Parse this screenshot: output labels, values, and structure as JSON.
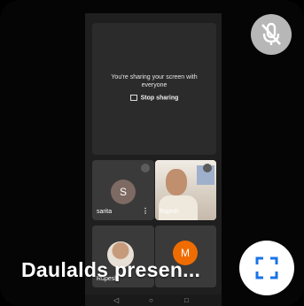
{
  "share": {
    "message": "You're sharing your screen with everyone",
    "stop_label": "Stop sharing"
  },
  "tiles": {
    "sarita": {
      "initial": "S",
      "name": "sarita",
      "avatar_color": "#7d6a63"
    },
    "video": {
      "name": "Rajesh"
    },
    "user3": {
      "name": "Rupesh"
    },
    "user4": {
      "initial": "M",
      "avatar_color": "#ef6c00"
    }
  },
  "controls": {
    "mic_off_icon": "mic-off-icon",
    "fullscreen_icon": "fullscreen-icon",
    "accent": "#1a73e8"
  },
  "presenter_label": "Daulalds presen..."
}
